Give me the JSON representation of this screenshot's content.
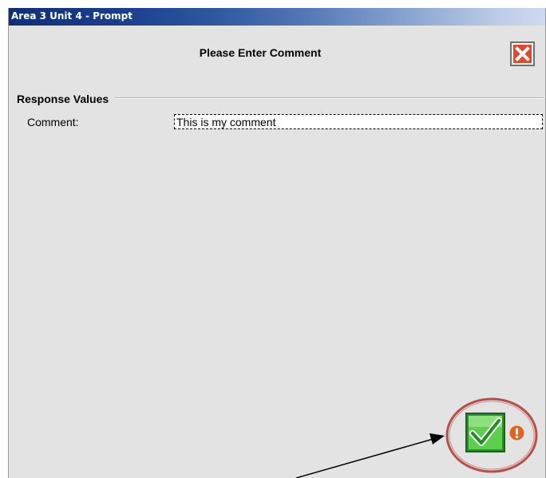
{
  "window": {
    "title": "Area 3 Unit 4 - Prompt",
    "heading": "Please Enter Comment"
  },
  "section": {
    "title": "Response Values"
  },
  "fields": {
    "comment_label": "Comment:",
    "comment_value": "This is my comment"
  },
  "icons": {
    "close": "close-icon",
    "ok": "checkmark-icon",
    "warning": "exclamation-icon"
  },
  "colors": {
    "titlebar_start": "#102e78",
    "close_red": "#e04a2a",
    "ok_green": "#3cbf3c",
    "warning_orange": "#e8621c",
    "annotation_ring": "#b4504a"
  }
}
